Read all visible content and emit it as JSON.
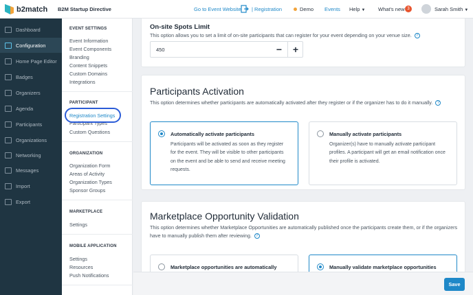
{
  "app": {
    "logo_text": "b2match",
    "event_name": "B2M Startup Directive"
  },
  "topnav": {
    "go_to_event": "Go to Event Website",
    "registration": "Registration",
    "demo": "Demo",
    "events": "Events",
    "help": "Help",
    "whats_new": "What's new",
    "whats_new_count": "3",
    "user_name": "Sarah Smith"
  },
  "colors": {
    "accent": "#1e88c8",
    "sidebar": "#1f3542",
    "badge": "#e8552f"
  },
  "sidebar": {
    "items": [
      {
        "label": "Dashboard",
        "icon": "dashboard-icon"
      },
      {
        "label": "Configuration",
        "icon": "settings-icon"
      },
      {
        "label": "Home Page Editor",
        "icon": "page-icon"
      },
      {
        "label": "Badges",
        "icon": "badge-icon"
      },
      {
        "label": "Organizers",
        "icon": "organizers-icon"
      },
      {
        "label": "Agenda",
        "icon": "calendar-icon"
      },
      {
        "label": "Participants",
        "icon": "participants-icon"
      },
      {
        "label": "Organizations",
        "icon": "building-icon"
      },
      {
        "label": "Networking",
        "icon": "networking-icon"
      },
      {
        "label": "Messages",
        "icon": "mail-icon"
      },
      {
        "label": "Import",
        "icon": "import-icon"
      },
      {
        "label": "Export",
        "icon": "export-icon"
      }
    ]
  },
  "submenu": {
    "event_settings": {
      "heading": "EVENT SETTINGS",
      "items": [
        "Event Information",
        "Event Components",
        "Branding",
        "Content Snippets",
        "Custom Domains",
        "Integrations"
      ]
    },
    "participant": {
      "heading": "PARTICIPANT",
      "items": [
        "Registration Settings",
        "Participant Types",
        "Custom Questions"
      ]
    },
    "organization": {
      "heading": "ORGANIZATION",
      "items": [
        "Organization Form",
        "Areas of Activity",
        "Organization Types",
        "Sponsor Groups"
      ]
    },
    "marketplace": {
      "heading": "MARKETPLACE",
      "items": [
        "Settings"
      ]
    },
    "mobile": {
      "heading": "MOBILE APPLICATION",
      "items": [
        "Settings",
        "Resources",
        "Push Notifications"
      ]
    }
  },
  "spots": {
    "title": "On-site Spots Limit",
    "description": "This option allows you to set a limit of on-site participants that can register for your event depending on your venue size.",
    "value": "450",
    "minus": "−",
    "plus": "+"
  },
  "activation": {
    "title": "Participants Activation",
    "description": "This option determines whether participants are automatically activated after they register or if the organizer has to do it manually.",
    "auto_title": "Automatically activate participants",
    "auto_desc_1": "Participants will be activated as soon as they register",
    "auto_desc_2": "for the event. They will be visible to other participants",
    "auto_desc_3": "on the event and be able to send and receive meeting",
    "auto_desc_4": "requests.",
    "manual_title": "Manually activate participants",
    "manual_desc_1": "Organizer(s) have to manually activate participant",
    "manual_desc_2": "profiles. A participant will get an email notification once",
    "manual_desc_3": "their profile is activated."
  },
  "marketplace_validation": {
    "title": "Marketplace Opportunity Validation",
    "description_1": "This option determines whether Marketplace Opportunities are automatically published once the participants create them, or if the organizers",
    "description_2": "have to manually publish them after reviewing.",
    "auto_title": "Marketplace opportunities are automatically",
    "manual_title": "Manually validate marketplace opportunities"
  },
  "footer": {
    "save_label": "Save"
  }
}
